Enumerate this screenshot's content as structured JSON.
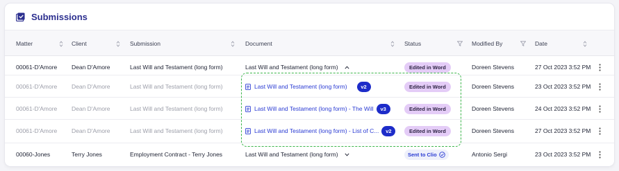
{
  "header": {
    "title": "Submissions",
    "icon": "checkbox-checked-icon",
    "accent": "#2c2f8f"
  },
  "columns": {
    "matter": "Matter",
    "client": "Client",
    "submission": "Submission",
    "document": "Document",
    "status": "Status",
    "modified_by": "Modified By",
    "date": "Date"
  },
  "rows": [
    {
      "matter": "00061-D'Amore",
      "client": "Dean D'Amore",
      "submission": "Last Will and Testament (long form)",
      "document": "Last Will and Testament (long form)",
      "status": "Edited in Word",
      "modified_by": "Doreen Stevens",
      "date": "27 Oct 2023 3:52 PM"
    },
    {
      "matter": "00061-D'Amore",
      "client": "Dean D'Amore",
      "submission": "Last Will and Testament (long form)",
      "document": "Last Will and Testament (long form)",
      "version": "v2",
      "status": "Edited in Word",
      "modified_by": "Doreen Stevens",
      "date": "23 Oct 2023 3:52 PM"
    },
    {
      "matter": "00061-D'Amore",
      "client": "Dean D'Amore",
      "submission": "Last Will and Testament (long form)",
      "document": "Last Will and Testament (long form) - The Will",
      "version": "v3",
      "status": "Edited in Word",
      "modified_by": "Doreen Stevens",
      "date": "24 Oct 2023 3:52 PM"
    },
    {
      "matter": "00061-D'Amore",
      "client": "Dean D'Amore",
      "submission": "Last Will and Testament (long form)",
      "document": "Last Will and Testament (long form) - List of C...",
      "version": "v2",
      "status": "Edited in Word",
      "modified_by": "Doreen Stevens",
      "date": "27 Oct 2023 3:52 PM"
    },
    {
      "matter": "00060-Jones",
      "client": "Terry Jones",
      "submission": "Employment Contract - Terry Jones",
      "document": "Last Will and Testament (long form)",
      "status": "Sent to Clio",
      "modified_by": "Antonio Sergi",
      "date": "23 Oct 2023 3:52 PM"
    }
  ],
  "colors": {
    "status_edited_bg": "#e4ccf7",
    "version_badge": "#1d2cc9",
    "link": "#2a3bd3",
    "highlight_border": "#3bb54a"
  }
}
